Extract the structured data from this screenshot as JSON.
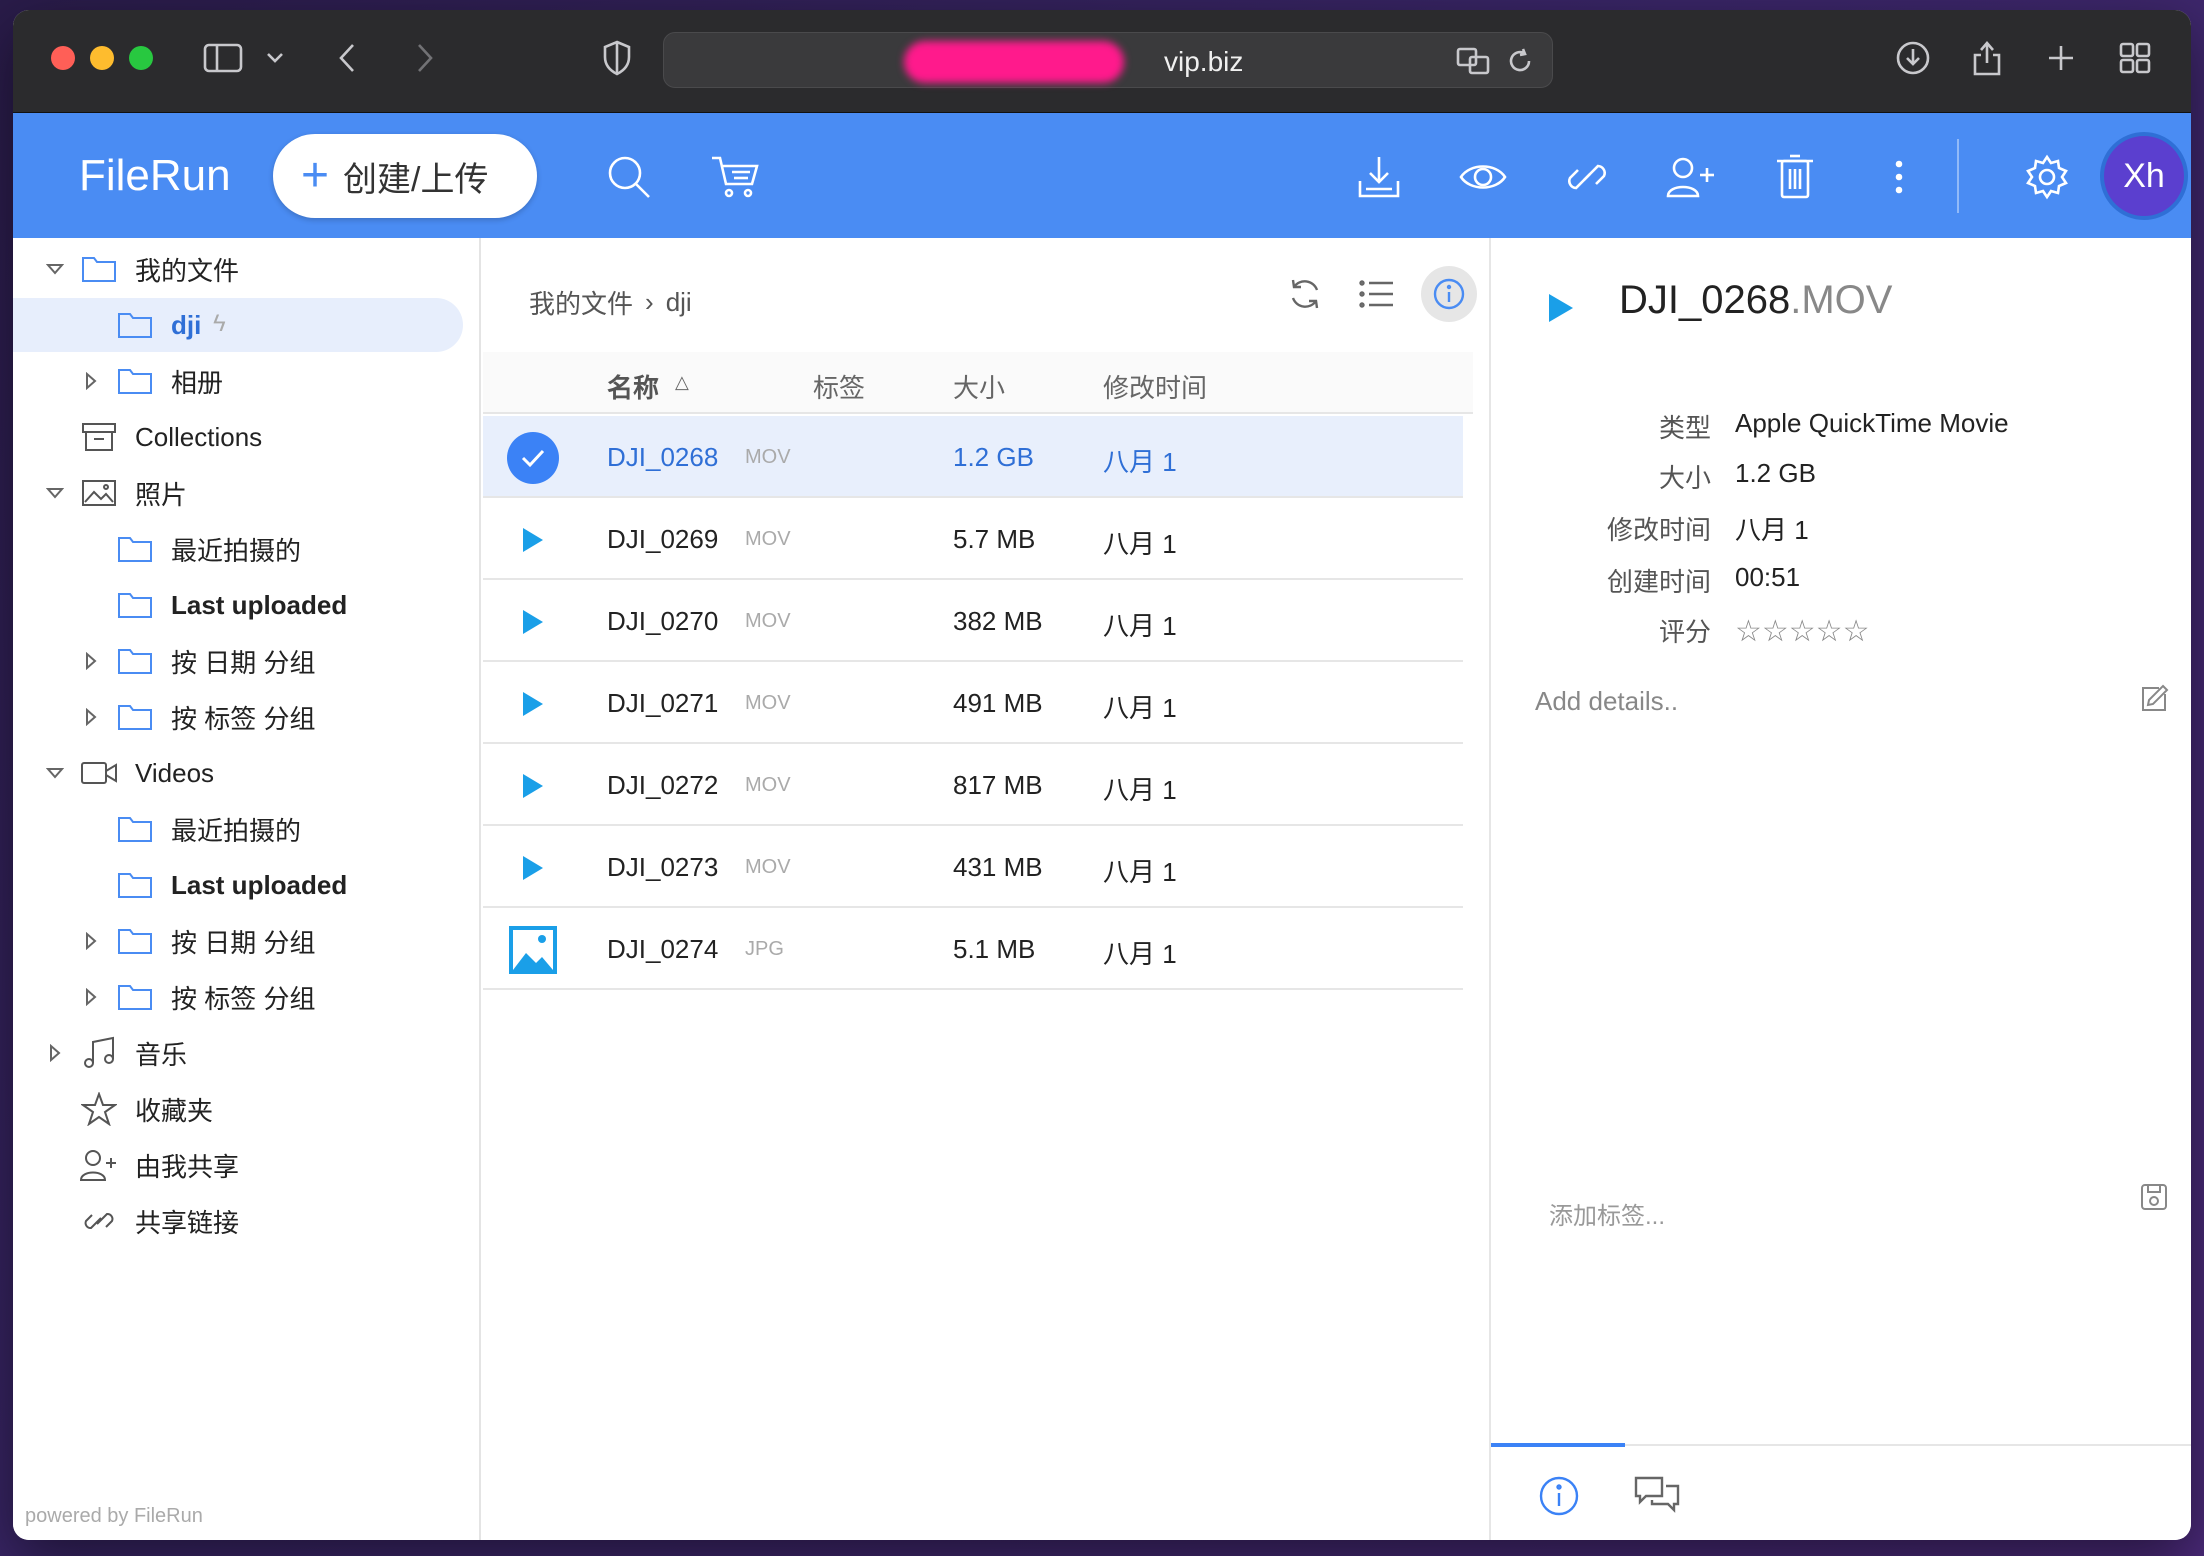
{
  "browser": {
    "url": "vip.biz"
  },
  "appbar": {
    "brand": "FileRun",
    "create_label": "创建/上传",
    "avatar_initials": "Xh"
  },
  "sidebar": {
    "items": [
      {
        "label": "我的文件"
      },
      {
        "label": "dji"
      },
      {
        "label": "相册"
      },
      {
        "label": "Collections"
      },
      {
        "label": "照片"
      },
      {
        "label": "最近拍摄的"
      },
      {
        "label": "Last uploaded"
      },
      {
        "label": "按 日期 分组"
      },
      {
        "label": "按 标签 分组"
      },
      {
        "label": "Videos"
      },
      {
        "label": "最近拍摄的"
      },
      {
        "label": "Last uploaded"
      },
      {
        "label": "按 日期 分组"
      },
      {
        "label": "按 标签 分组"
      },
      {
        "label": "音乐"
      },
      {
        "label": "收藏夹"
      },
      {
        "label": "由我共享"
      },
      {
        "label": "共享链接"
      }
    ],
    "powered_by": "powered by FileRun"
  },
  "center": {
    "breadcrumb": [
      "我的文件",
      "dji"
    ],
    "columns": {
      "name": "名称",
      "tags": "标签",
      "size": "大小",
      "modified": "修改时间"
    },
    "files": [
      {
        "name": "DJI_0268",
        "ext": "MOV",
        "size": "1.2 GB",
        "modified": "八月 1"
      },
      {
        "name": "DJI_0269",
        "ext": "MOV",
        "size": "5.7 MB",
        "modified": "八月 1"
      },
      {
        "name": "DJI_0270",
        "ext": "MOV",
        "size": "382 MB",
        "modified": "八月 1"
      },
      {
        "name": "DJI_0271",
        "ext": "MOV",
        "size": "491 MB",
        "modified": "八月 1"
      },
      {
        "name": "DJI_0272",
        "ext": "MOV",
        "size": "817 MB",
        "modified": "八月 1"
      },
      {
        "name": "DJI_0273",
        "ext": "MOV",
        "size": "431 MB",
        "modified": "八月 1"
      },
      {
        "name": "DJI_0274",
        "ext": "JPG",
        "size": "5.1 MB",
        "modified": "八月 1"
      }
    ]
  },
  "details": {
    "title_name": "DJI_0268",
    "title_ext": ".MOV",
    "props": [
      {
        "key": "类型",
        "value": "Apple QuickTime Movie"
      },
      {
        "key": "大小",
        "value": "1.2 GB"
      },
      {
        "key": "修改时间",
        "value": "八月 1"
      },
      {
        "key": "创建时间",
        "value": "00:51"
      },
      {
        "key": "评分",
        "value": ""
      }
    ],
    "stars": "☆☆☆☆☆",
    "add_details": "Add details..",
    "tag_placeholder": "添加标签..."
  },
  "colors": {
    "accent": "#4a8cf3",
    "selected_row": "#e8effc",
    "play": "#1a9fe8"
  }
}
